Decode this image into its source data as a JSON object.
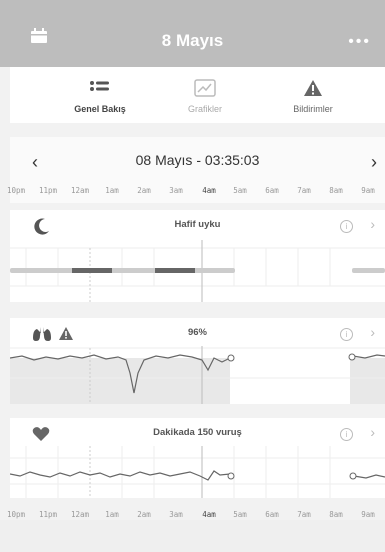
{
  "header": {
    "title": "8 Mayıs",
    "calendar_icon": "calendar-icon",
    "more_icon": "more-dots-icon",
    "more_glyph": "•••"
  },
  "tabs": [
    {
      "label": "Genel Bakış",
      "icon": "list-icon",
      "active": true
    },
    {
      "label": "Grafikler",
      "icon": "chart-icon",
      "active": false
    },
    {
      "label": "Bildirimler",
      "icon": "warning-icon",
      "active": false
    }
  ],
  "datebar": {
    "date_text": "08 Mayıs - 03:35:03",
    "prev_glyph": "‹",
    "next_glyph": "›"
  },
  "hours": [
    "10pm",
    "11pm",
    "12am",
    "1am",
    "2am",
    "3am",
    "4am",
    "5am",
    "6am",
    "7am",
    "8am",
    "9am"
  ],
  "panels": {
    "sleep": {
      "title": "Hafif uyku",
      "icon": "moon-icon"
    },
    "oxygen": {
      "title": "96%",
      "icon": "lungs-icon",
      "warning_icon": "warning-icon"
    },
    "heart": {
      "title": "Dakikada 150 vuruş",
      "icon": "heart-icon"
    }
  },
  "info_glyph": "i",
  "chevron_glyph": "›",
  "colors": {
    "header": "#bdbdbd",
    "line": "#666666",
    "bar": "#cccccc",
    "bar_dark": "#666666"
  }
}
